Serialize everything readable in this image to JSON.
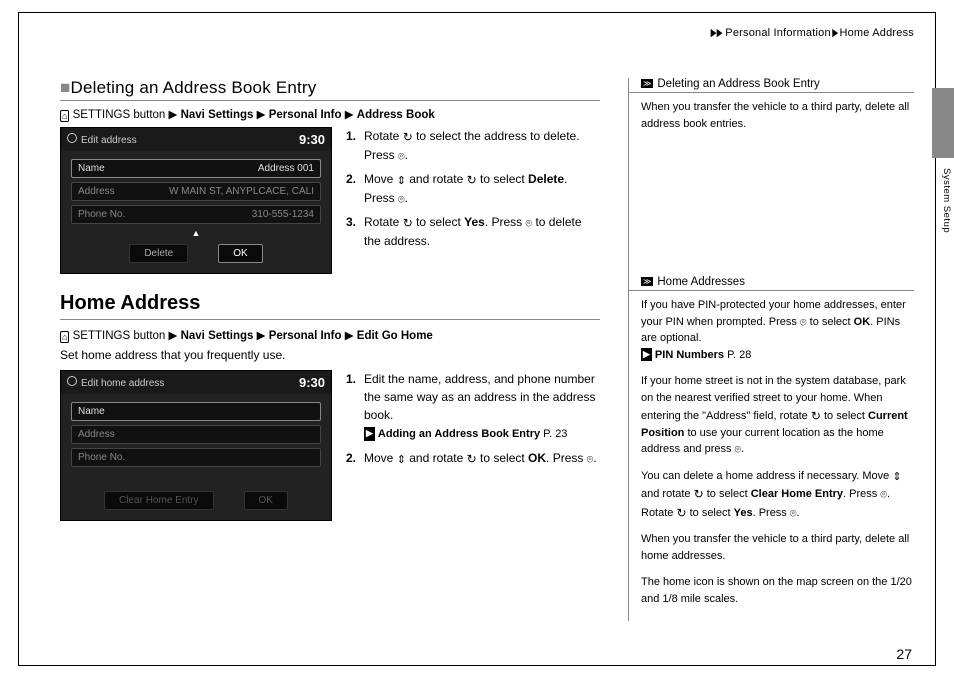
{
  "breadcrumb": {
    "level1": "Personal Information",
    "level2": "Home Address"
  },
  "side_tab": "System Setup",
  "page_number": "27",
  "sec1": {
    "heading": "Deleting an Address Book Entry",
    "path_prefix": "SETTINGS button",
    "path_items": [
      "Navi Settings",
      "Personal Info",
      "Address Book"
    ],
    "shot": {
      "title": "Edit address",
      "time": "9:30",
      "rows": [
        {
          "label": "Name",
          "value": "Address 001"
        },
        {
          "label": "Address",
          "value": "W MAIN ST, ANYPLCACE, CALI"
        },
        {
          "label": "Phone No.",
          "value": "310-555-1234"
        }
      ],
      "btn_left": "Delete",
      "btn_right": "OK"
    },
    "steps": [
      {
        "n": "1.",
        "a": "Rotate ",
        "b": " to select the address to delete. Press ",
        "c": "."
      },
      {
        "n": "2.",
        "a": "Move ",
        "b": " and rotate ",
        "c": " to select ",
        "bold": "Delete",
        "d": ". Press ",
        "e": "."
      },
      {
        "n": "3.",
        "a": "Rotate ",
        "b": " to select ",
        "bold": "Yes",
        "c": ". Press ",
        "d": " to delete the address."
      }
    ]
  },
  "sec2": {
    "heading": "Home Address",
    "path_prefix": "SETTINGS button",
    "path_items": [
      "Navi Settings",
      "Personal Info",
      "Edit Go Home"
    ],
    "intro": "Set home address that you frequently use.",
    "shot": {
      "title": "Edit home address",
      "time": "9:30",
      "rows": [
        {
          "label": "Name",
          "value": ""
        },
        {
          "label": "Address",
          "value": ""
        },
        {
          "label": "Phone No.",
          "value": ""
        }
      ],
      "btn_left": "Clear Home Entry",
      "btn_right": "OK"
    },
    "steps": [
      {
        "n": "1.",
        "text": "Edit the name, address, and phone number the same way as an address in the address book.",
        "ref": "Adding an Address Book Entry",
        "ref_page": "P. 23"
      },
      {
        "n": "2.",
        "a": "Move ",
        "b": " and rotate ",
        "c": " to select ",
        "bold": "OK",
        "d": ". Press ",
        "e": "."
      }
    ]
  },
  "side": {
    "h1": "Deleting an Address Book Entry",
    "p1": "When you transfer the vehicle to a third party, delete all address book entries.",
    "h2": "Home Addresses",
    "p2a": "If you have PIN-protected your home addresses, enter your PIN when prompted. Press ",
    "p2b": " to select ",
    "p2bold": "OK",
    "p2c": ". PINs are optional.",
    "ref2": "PIN Numbers",
    "ref2_page": "P. 28",
    "p3a": "If your home street is not in the system database, park on the nearest verified street to your home. When entering the \"Address\" field, rotate ",
    "p3b": " to select ",
    "p3bold": "Current Position",
    "p3c": " to use your current location as the home address and press ",
    "p3d": ".",
    "p4a": "You can delete a home address if necessary. Move ",
    "p4b": " and rotate ",
    "p4c": " to select ",
    "p4bold1": "Clear Home Entry",
    "p4d": ". Press ",
    "p4e": ". Rotate ",
    "p4f": " to select ",
    "p4bold2": "Yes",
    "p4g": ". Press ",
    "p4h": ".",
    "p5": "When you transfer the vehicle to a third party, delete all home addresses.",
    "p6": "The home icon is shown on the map screen on the 1/20 and 1/8 mile scales."
  }
}
